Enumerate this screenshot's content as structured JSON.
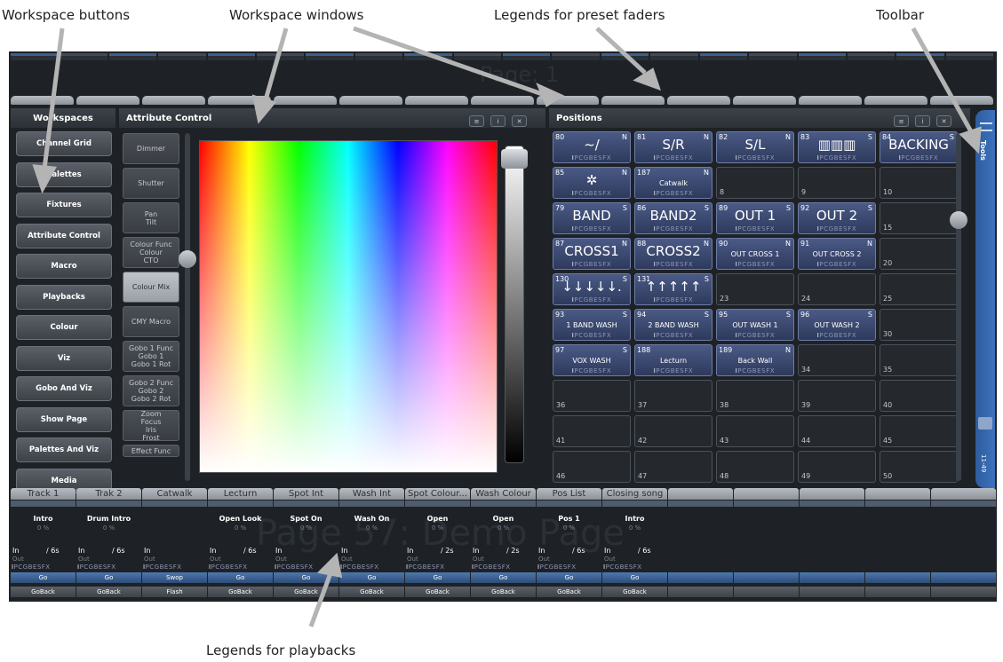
{
  "callouts": {
    "workspace_buttons": "Workspace buttons",
    "workspace_windows": "Workspace windows",
    "legends_preset_faders": "Legends for preset faders",
    "toolbar": "Toolbar",
    "legends_playbacks": "Legends for playbacks"
  },
  "watermarks": {
    "page_top": "Page: 1",
    "page_playbacks": "Page 57: Demo Page"
  },
  "workspaces": {
    "title": "Workspaces",
    "items": [
      "Channel Grid",
      "Palettes",
      "Fixtures",
      "Attribute Control",
      "Macro",
      "Playbacks",
      "Colour",
      "Viz",
      "Gobo And Viz",
      "Show Page",
      "Palettes And Viz",
      "Media"
    ]
  },
  "attribute_control": {
    "title": "Attribute Control",
    "buttons": [
      "Dimmer",
      "Shutter",
      "Pan\nTilt",
      "Colour Func\nColour\nCTO",
      "Colour Mix",
      "CMY Macro",
      "Gobo 1 Func\nGobo 1\nGobo 1 Rot",
      "Gobo 2 Func\nGobo 2\nGobo 2 Rot",
      "Zoom\nFocus\nIris\nFrost",
      "Effect Func"
    ],
    "selected": "Colour Mix"
  },
  "positions": {
    "title": "Positions",
    "attr_legend": "IPCGBESFX",
    "cells": [
      {
        "num": "80",
        "flag": "N",
        "label": "~/",
        "full": true
      },
      {
        "num": "81",
        "flag": "N",
        "label": "S/R",
        "full": true
      },
      {
        "num": "82",
        "flag": "N",
        "label": "S/L",
        "full": true
      },
      {
        "num": "83",
        "flag": "S",
        "label": "▥▥▥",
        "full": true
      },
      {
        "num": "84",
        "flag": "S",
        "label": "BACKING",
        "full": true
      },
      {
        "num": "85",
        "flag": "N",
        "label": "✲",
        "full": true
      },
      {
        "num": "187",
        "flag": "N",
        "label": "Catwalk",
        "full": true,
        "small": true
      },
      {
        "num": "8",
        "full": false
      },
      {
        "num": "9",
        "full": false
      },
      {
        "num": "10",
        "full": false
      },
      {
        "num": "79",
        "flag": "S",
        "label": "BAND",
        "full": true
      },
      {
        "num": "86",
        "flag": "S",
        "label": "BAND2",
        "full": true
      },
      {
        "num": "89",
        "flag": "S",
        "label": "OUT 1",
        "full": true
      },
      {
        "num": "92",
        "flag": "S",
        "label": "OUT 2",
        "full": true
      },
      {
        "num": "15",
        "full": false
      },
      {
        "num": "87",
        "flag": "N",
        "label": "CROSS1",
        "full": true
      },
      {
        "num": "88",
        "flag": "N",
        "label": "CROSS2",
        "full": true
      },
      {
        "num": "90",
        "flag": "N",
        "label": "OUT CROSS 1",
        "full": true,
        "small": true
      },
      {
        "num": "91",
        "flag": "N",
        "label": "OUT CROSS 2",
        "full": true,
        "small": true
      },
      {
        "num": "20",
        "full": false
      },
      {
        "num": "130",
        "flag": "S",
        "label": "↓↓↓↓↓.",
        "full": true
      },
      {
        "num": "131",
        "flag": "S",
        "label": "↑↑↑↑↑",
        "full": true
      },
      {
        "num": "23",
        "full": false
      },
      {
        "num": "24",
        "full": false
      },
      {
        "num": "25",
        "full": false
      },
      {
        "num": "93",
        "flag": "S",
        "label": "1 BAND WASH",
        "full": true,
        "small": true
      },
      {
        "num": "94",
        "flag": "S",
        "label": "2 BAND WASH",
        "full": true,
        "small": true
      },
      {
        "num": "95",
        "flag": "S",
        "label": "OUT WASH 1",
        "full": true,
        "small": true
      },
      {
        "num": "96",
        "flag": "S",
        "label": "OUT WASH 2",
        "full": true,
        "small": true
      },
      {
        "num": "30",
        "full": false
      },
      {
        "num": "97",
        "flag": "S",
        "label": "VOX WASH",
        "full": true,
        "small": true
      },
      {
        "num": "188",
        "flag": "",
        "label": "Lecturn",
        "full": true,
        "small": true
      },
      {
        "num": "189",
        "flag": "N",
        "label": "Back Wall",
        "full": true,
        "small": true
      },
      {
        "num": "34",
        "full": false
      },
      {
        "num": "35",
        "full": false
      },
      {
        "num": "36",
        "full": false
      },
      {
        "num": "37",
        "full": false
      },
      {
        "num": "38",
        "full": false
      },
      {
        "num": "39",
        "full": false
      },
      {
        "num": "40",
        "full": false
      },
      {
        "num": "41",
        "full": false
      },
      {
        "num": "42",
        "full": false
      },
      {
        "num": "43",
        "full": false
      },
      {
        "num": "44",
        "full": false
      },
      {
        "num": "45",
        "full": false
      },
      {
        "num": "46",
        "full": false
      },
      {
        "num": "47",
        "full": false
      },
      {
        "num": "48",
        "full": false
      },
      {
        "num": "49",
        "full": false
      },
      {
        "num": "50",
        "full": false
      }
    ]
  },
  "playbacks": [
    {
      "tab": "Track 1",
      "name": "Intro",
      "pct": "0 %",
      "in": "In",
      "time": "/ 6s",
      "out": "Out",
      "attr": "IPCGBESFX",
      "go": "Go",
      "back": "GoBack"
    },
    {
      "tab": "Trak 2",
      "name": "Drum Intro",
      "pct": "0 %",
      "in": "In",
      "time": "/ 6s",
      "out": "Out",
      "attr": "IPCGBESFX",
      "go": "Go",
      "back": "GoBack"
    },
    {
      "tab": "Catwalk",
      "name": "",
      "pct": "",
      "in": "In",
      "time": "",
      "out": "Out",
      "attr": "IPCGBESFX",
      "go": "Swop",
      "back": "Flash"
    },
    {
      "tab": "Lecturn",
      "name": "Open Look",
      "pct": "0 %",
      "in": "In",
      "time": "/ 6s",
      "out": "Out",
      "attr": "IPCGBESFX",
      "go": "Go",
      "back": "GoBack"
    },
    {
      "tab": "Spot Int",
      "name": "Spot On",
      "pct": "0 %",
      "in": "In",
      "time": "",
      "out": "Out",
      "attr": "IPCGBESFX",
      "go": "Go",
      "back": "GoBack"
    },
    {
      "tab": "Wash Int",
      "name": "Wash On",
      "pct": "0 %",
      "in": "In",
      "time": "",
      "out": "Out",
      "attr": "IPCGBESFX",
      "go": "Go",
      "back": "GoBack"
    },
    {
      "tab": "Spot Colour...",
      "name": "Open",
      "pct": "0 %",
      "in": "In",
      "time": "/ 2s",
      "out": "Out",
      "attr": "IPCGBESFX",
      "go": "Go",
      "back": "GoBack"
    },
    {
      "tab": "Wash Colour",
      "name": "Open",
      "pct": "0 %",
      "in": "In",
      "time": "/ 2s",
      "out": "Out",
      "attr": "IPCGBESFX",
      "go": "Go",
      "back": "GoBack"
    },
    {
      "tab": "Pos List",
      "name": "Pos 1",
      "pct": "0 %",
      "in": "In",
      "time": "/ 6s",
      "out": "Out",
      "attr": "IPCGBESFX",
      "go": "Go",
      "back": "GoBack"
    },
    {
      "tab": "Closing song",
      "name": "Intro",
      "pct": "0 %",
      "in": "In",
      "time": "/ 6s",
      "out": "Out",
      "attr": "IPCGBESFX",
      "go": "Go",
      "back": "GoBack"
    }
  ],
  "toolbar": {
    "tools_label": "Tools",
    "range_label": "11-49"
  },
  "colors": {
    "accent": "#3d72bd",
    "panel": "#1e2226",
    "preset_full": "#3e4d76"
  }
}
